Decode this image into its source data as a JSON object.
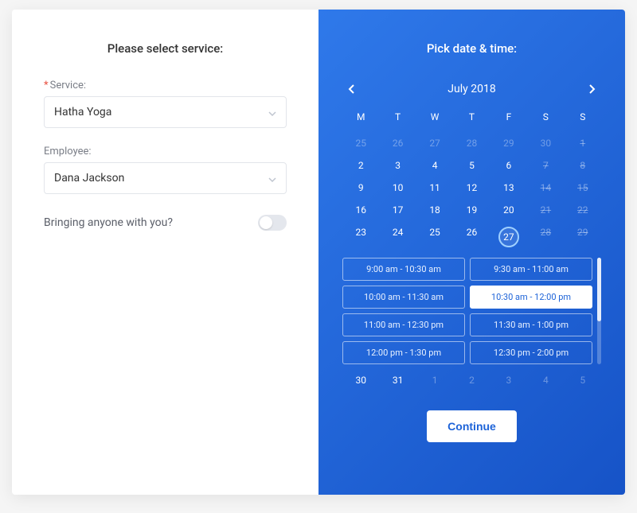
{
  "left": {
    "title": "Please select service:",
    "service_label": "Service:",
    "service_value": "Hatha Yoga",
    "employee_label": "Employee:",
    "employee_value": "Dana Jackson",
    "toggle_label": "Bringing anyone with you?",
    "toggle_on": false
  },
  "right": {
    "title": "Pick date & time:",
    "month_year": "July 2018",
    "dow": [
      "M",
      "T",
      "W",
      "T",
      "F",
      "S",
      "S"
    ],
    "weeks": [
      [
        {
          "n": 25,
          "outside": true
        },
        {
          "n": 26,
          "outside": true
        },
        {
          "n": 27,
          "outside": true
        },
        {
          "n": 28,
          "outside": true
        },
        {
          "n": 29,
          "outside": true
        },
        {
          "n": 30,
          "outside": true
        },
        {
          "n": 1,
          "disabled": true
        }
      ],
      [
        {
          "n": 2
        },
        {
          "n": 3
        },
        {
          "n": 4
        },
        {
          "n": 5
        },
        {
          "n": 6
        },
        {
          "n": 7,
          "disabled": true
        },
        {
          "n": 8,
          "disabled": true
        }
      ],
      [
        {
          "n": 9
        },
        {
          "n": 10
        },
        {
          "n": 11
        },
        {
          "n": 12
        },
        {
          "n": 13
        },
        {
          "n": 14,
          "disabled": true
        },
        {
          "n": 15,
          "disabled": true
        }
      ],
      [
        {
          "n": 16
        },
        {
          "n": 17
        },
        {
          "n": 18
        },
        {
          "n": 19
        },
        {
          "n": 20
        },
        {
          "n": 21,
          "disabled": true
        },
        {
          "n": 22,
          "disabled": true
        }
      ],
      [
        {
          "n": 23
        },
        {
          "n": 24
        },
        {
          "n": 25
        },
        {
          "n": 26
        },
        {
          "n": 27,
          "selected": true
        },
        {
          "n": 28,
          "disabled": true
        },
        {
          "n": 29,
          "disabled": true
        }
      ]
    ],
    "trailing_week": [
      {
        "n": 30
      },
      {
        "n": 31
      },
      {
        "n": 1,
        "outside": true
      },
      {
        "n": 2,
        "outside": true
      },
      {
        "n": 3,
        "outside": true
      },
      {
        "n": 4,
        "outside": true
      },
      {
        "n": 5,
        "outside": true
      }
    ],
    "slots": [
      {
        "label": "9:00 am - 10:30 am"
      },
      {
        "label": "9:30 am - 11:00 am"
      },
      {
        "label": "10:00 am - 11:30 am"
      },
      {
        "label": "10:30 am - 12:00 pm",
        "selected": true
      },
      {
        "label": "11:00 am - 12:30 pm"
      },
      {
        "label": "11:30 am - 1:00 pm"
      },
      {
        "label": "12:00 pm - 1:30 pm"
      },
      {
        "label": "12:30 pm - 2:00 pm"
      }
    ],
    "continue_label": "Continue"
  }
}
